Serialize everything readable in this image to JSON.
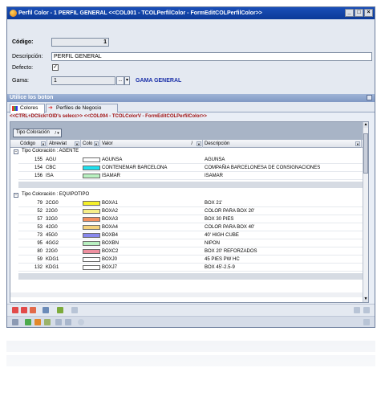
{
  "window": {
    "title": "Perfil Color - 1  PERFIL GENERAL  <<COL001 - TCOLPerfilColor - FormEditCOLPerfilColor>>",
    "controls": [
      "_",
      "□",
      "×"
    ]
  },
  "form": {
    "codigo_label": "Código:",
    "codigo_value": "1",
    "descripcion_label": "Descripción:",
    "descripcion_value": "PERFIL GENERAL",
    "defecto_label": "Defecto:",
    "defecto_checked": "✓",
    "gama_label": "Gama:",
    "gama_value": "1",
    "gama_btn": "...",
    "gama_btn2": "▾",
    "gama_name": "GAMA GENERAL"
  },
  "section": {
    "title": "Utilice los boton"
  },
  "tabs": [
    {
      "label": "Colores",
      "icon": "palette-icon"
    },
    {
      "label": "Perfiles de Negocio",
      "icon": "arrow-icon"
    }
  ],
  "hint": "<<CTRL+DClick=OID's selecc>> <<COL004 - TCOLColorV - FormEditCOLPerfilColor>>",
  "grid": {
    "group_chip": "Tipo Coloración",
    "columns": [
      "Código",
      "Abreviat",
      "Colo",
      "Valor",
      "Descripción"
    ],
    "groups": [
      {
        "label": "Tipo Coloración : AGENTE",
        "rows": [
          {
            "codigo": "155",
            "abrev": "AGU",
            "color": "#ffffff",
            "valor": "AGUNSA",
            "desc": "AGUNSA"
          },
          {
            "codigo": "154",
            "abrev": "CBC",
            "color": "#1ee0ee",
            "valor": "CONTENEMAR BARCELONA",
            "desc": "COMPAÑIA BARCELONESA DE CONSIGNACIONES"
          },
          {
            "codigo": "156",
            "abrev": "ISA",
            "color": "#b8f0c0",
            "valor": "ISAMAR",
            "desc": "ISAMAR"
          }
        ]
      },
      {
        "label": "Tipo Coloración : EQUIPOTIPO",
        "rows": [
          {
            "codigo": "79",
            "abrev": "2CG0",
            "color": "#f4f02a",
            "valor": "BOXA1",
            "desc": "BOX 21'"
          },
          {
            "codigo": "52",
            "abrev": "22G0",
            "color": "#f6ee88",
            "valor": "BOXA2",
            "desc": "COLOR PARA BOX 20'"
          },
          {
            "codigo": "57",
            "abrev": "32G0",
            "color": "#f39060",
            "valor": "BOXA3",
            "desc": "BOX 30 PIES"
          },
          {
            "codigo": "53",
            "abrev": "42G0",
            "color": "#f4d27c",
            "valor": "BOXA4",
            "desc": "COLOR PARA BOX 40'"
          },
          {
            "codigo": "73",
            "abrev": "45G0",
            "color": "#8888ee",
            "valor": "BOXB4",
            "desc": "40' HIGH CUBE"
          },
          {
            "codigo": "95",
            "abrev": "4GG2",
            "color": "#b8f0c0",
            "valor": "BOXBN",
            "desc": "NIPON"
          },
          {
            "codigo": "80",
            "abrev": "22G0",
            "color": "#ee90a0",
            "valor": "BOXC2",
            "desc": "BOX 20' REFORZADOS"
          },
          {
            "codigo": "59",
            "abrev": "KDG1",
            "color": "#ffffff",
            "valor": "BOXJ0",
            "desc": "45 PIES PW HC"
          },
          {
            "codigo": "132",
            "abrev": "KDG1",
            "color": "#ffffff",
            "valor": "BOXJ7",
            "desc": "BOX 45'-2.5-9"
          }
        ]
      }
    ]
  }
}
